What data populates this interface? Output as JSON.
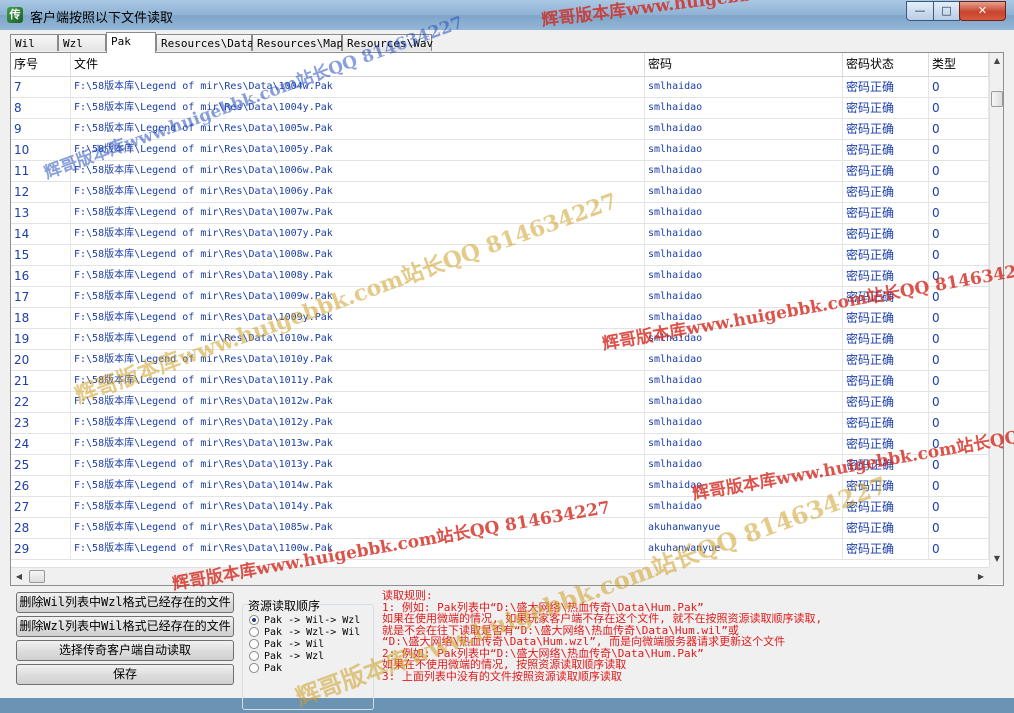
{
  "window": {
    "title": "客户端按照以下文件读取",
    "icon_glyph": "传",
    "controls": {
      "minimize": "—",
      "maximize": "□",
      "close": "✕"
    }
  },
  "tabs": [
    {
      "label": "Wil",
      "active": false
    },
    {
      "label": "Wzl",
      "active": false
    },
    {
      "label": "Pak",
      "active": true
    },
    {
      "label": "Resources\\Data",
      "active": false
    },
    {
      "label": "Resources\\Map",
      "active": false
    },
    {
      "label": "Resources\\Wav",
      "active": false
    }
  ],
  "list": {
    "columns": [
      "序号",
      "文件",
      "密码",
      "密码状态",
      "类型"
    ],
    "rows": [
      {
        "no": "7",
        "file": "F:\\58版本库\\Legend of mir\\Res\\Data\\1004w.Pak",
        "password": "smlhaidao",
        "status": "密码正确",
        "type": "0"
      },
      {
        "no": "8",
        "file": "F:\\58版本库\\Legend of mir\\Res\\Data\\1004y.Pak",
        "password": "smlhaidao",
        "status": "密码正确",
        "type": "0"
      },
      {
        "no": "9",
        "file": "F:\\58版本库\\Legend of mir\\Res\\Data\\1005w.Pak",
        "password": "smlhaidao",
        "status": "密码正确",
        "type": "0"
      },
      {
        "no": "10",
        "file": "F:\\58版本库\\Legend of mir\\Res\\Data\\1005y.Pak",
        "password": "smlhaidao",
        "status": "密码正确",
        "type": "0"
      },
      {
        "no": "11",
        "file": "F:\\58版本库\\Legend of mir\\Res\\Data\\1006w.Pak",
        "password": "smlhaidao",
        "status": "密码正确",
        "type": "0"
      },
      {
        "no": "12",
        "file": "F:\\58版本库\\Legend of mir\\Res\\Data\\1006y.Pak",
        "password": "smlhaidao",
        "status": "密码正确",
        "type": "0"
      },
      {
        "no": "13",
        "file": "F:\\58版本库\\Legend of mir\\Res\\Data\\1007w.Pak",
        "password": "smlhaidao",
        "status": "密码正确",
        "type": "0"
      },
      {
        "no": "14",
        "file": "F:\\58版本库\\Legend of mir\\Res\\Data\\1007y.Pak",
        "password": "smlhaidao",
        "status": "密码正确",
        "type": "0"
      },
      {
        "no": "15",
        "file": "F:\\58版本库\\Legend of mir\\Res\\Data\\1008w.Pak",
        "password": "smlhaidao",
        "status": "密码正确",
        "type": "0"
      },
      {
        "no": "16",
        "file": "F:\\58版本库\\Legend of mir\\Res\\Data\\1008y.Pak",
        "password": "smlhaidao",
        "status": "密码正确",
        "type": "0"
      },
      {
        "no": "17",
        "file": "F:\\58版本库\\Legend of mir\\Res\\Data\\1009w.Pak",
        "password": "smlhaidao",
        "status": "密码正确",
        "type": "0"
      },
      {
        "no": "18",
        "file": "F:\\58版本库\\Legend of mir\\Res\\Data\\1009y.Pak",
        "password": "smlhaidao",
        "status": "密码正确",
        "type": "0"
      },
      {
        "no": "19",
        "file": "F:\\58版本库\\Legend of mir\\Res\\Data\\1010w.Pak",
        "password": "smlhaidao",
        "status": "密码正确",
        "type": "0"
      },
      {
        "no": "20",
        "file": "F:\\58版本库\\Legend of mir\\Res\\Data\\1010y.Pak",
        "password": "smlhaidao",
        "status": "密码正确",
        "type": "0"
      },
      {
        "no": "21",
        "file": "F:\\58版本库\\Legend of mir\\Res\\Data\\1011y.Pak",
        "password": "smlhaidao",
        "status": "密码正确",
        "type": "0"
      },
      {
        "no": "22",
        "file": "F:\\58版本库\\Legend of mir\\Res\\Data\\1012w.Pak",
        "password": "smlhaidao",
        "status": "密码正确",
        "type": "0"
      },
      {
        "no": "23",
        "file": "F:\\58版本库\\Legend of mir\\Res\\Data\\1012y.Pak",
        "password": "smlhaidao",
        "status": "密码正确",
        "type": "0"
      },
      {
        "no": "24",
        "file": "F:\\58版本库\\Legend of mir\\Res\\Data\\1013w.Pak",
        "password": "smlhaidao",
        "status": "密码正确",
        "type": "0"
      },
      {
        "no": "25",
        "file": "F:\\58版本库\\Legend of mir\\Res\\Data\\1013y.Pak",
        "password": "smlhaidao",
        "status": "密码正确",
        "type": "0"
      },
      {
        "no": "26",
        "file": "F:\\58版本库\\Legend of mir\\Res\\Data\\1014w.Pak",
        "password": "smlhaidao",
        "status": "密码正确",
        "type": "0"
      },
      {
        "no": "27",
        "file": "F:\\58版本库\\Legend of mir\\Res\\Data\\1014y.Pak",
        "password": "smlhaidao",
        "status": "密码正确",
        "type": "0"
      },
      {
        "no": "28",
        "file": "F:\\58版本库\\Legend of mir\\Res\\Data\\1085w.Pak",
        "password": "akuhanwanyue",
        "status": "密码正确",
        "type": "0"
      },
      {
        "no": "29",
        "file": "F:\\58版本库\\Legend of mir\\Res\\Data\\1100w.Pak",
        "password": "akuhanwanyue",
        "status": "密码正确",
        "type": "0"
      }
    ]
  },
  "buttons": {
    "delete_wil": "删除Wil列表中Wzl格式已经存在的文件",
    "delete_wzl": "删除Wzl列表中Wil格式已经存在的文件",
    "choose_client": "选择传奇客户端自动读取",
    "save": "保存"
  },
  "read_order": {
    "title": "资源读取顺序",
    "options": [
      {
        "label": "Pak -> Wil-> Wzl",
        "checked": true
      },
      {
        "label": "Pak -> Wzl-> Wil",
        "checked": false
      },
      {
        "label": "Pak -> Wil",
        "checked": false
      },
      {
        "label": "Pak -> Wzl",
        "checked": false
      },
      {
        "label": "Pak",
        "checked": false
      }
    ]
  },
  "rules": {
    "title": "读取规则:",
    "lines": [
      "1: 例如: Pak列表中“D:\\盛大网络\\热血传奇\\Data\\Hum.Pak”",
      "    如果在使用微端的情况, 如果玩家客户端不存在这个文件, 就不在按照资源读取顺序读取,",
      "    就是不会在往下读取是否有“D:\\盛大网络\\热血传奇\\Data\\Hum.wil”或",
      "    “D:\\盛大网络\\热血传奇\\Data\\Hum.wzl”, 而是向微端服务器请求更新这个文件",
      "2: 例如: Pak列表中“D:\\盛大网络\\热血传奇\\Data\\Hum.Pak”",
      "    如果在不使用微端的情况, 按照资源读取顺序读取",
      "3: 上面列表中没有的文件按照资源读取顺序读取"
    ],
    "color": "#e01a1a"
  },
  "watermarks": [
    "辉哥版本库www.huigebbk.com站长QQ 814634227",
    "辉哥版本库www.huigebbk.com站长QQ 814634227",
    "辉哥版本库www.huigebbk.com站长QQ 814634227",
    "辉哥版本库www.huigebbk.com站长QQ 814634227",
    "辉哥版本库www.huigebbk.com站长QQ 814634227",
    "辉哥版本库www.huigebbk.com站长QQ 814634227",
    "辉哥版本库www.huigebbk.com站长QQ 814634227"
  ],
  "colors": {
    "list_text": "#1b3ea8",
    "rules_text": "#e01a1a",
    "close_button": "#c7452e"
  }
}
